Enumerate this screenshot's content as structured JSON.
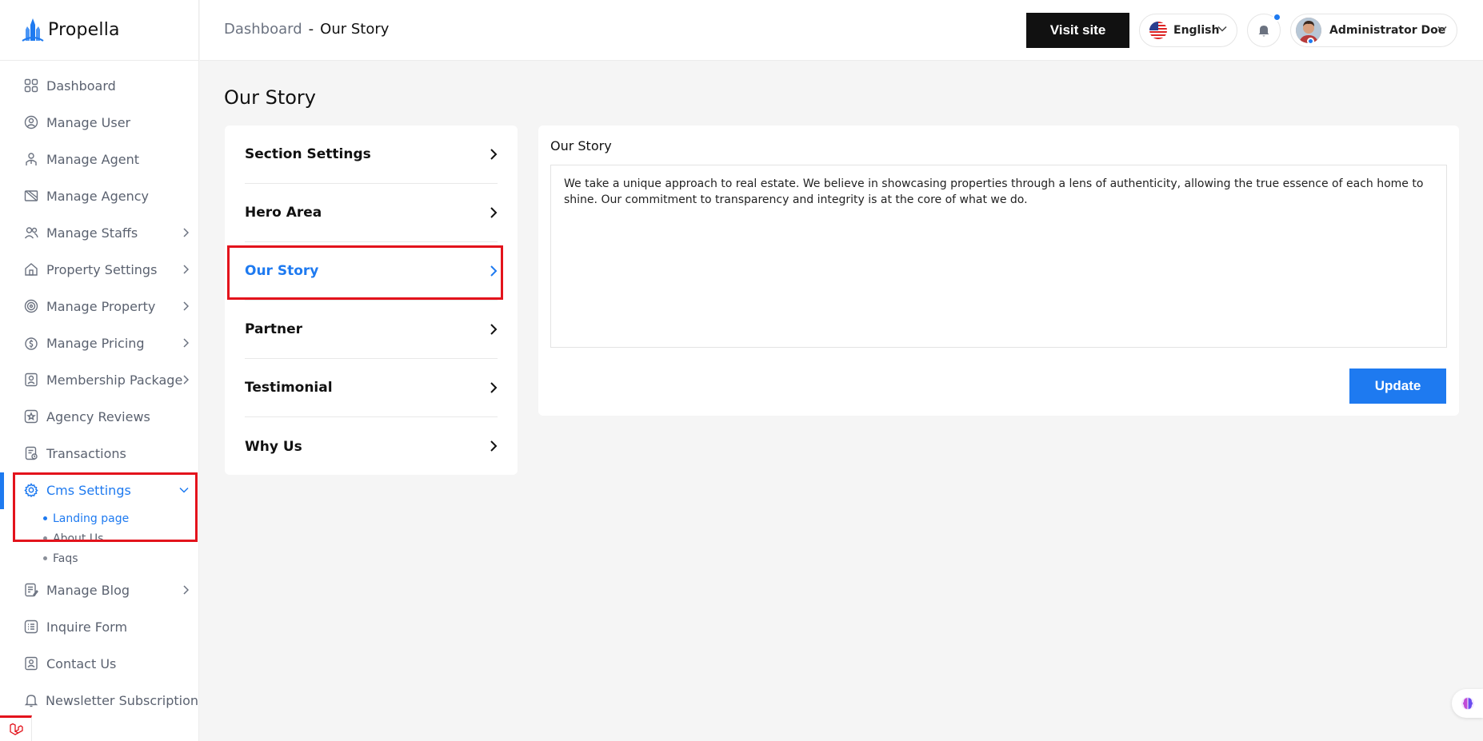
{
  "brand": {
    "name": "Propella"
  },
  "sidebar": {
    "items": [
      {
        "label": "Dashboard",
        "icon": "grid-icon"
      },
      {
        "label": "Manage User",
        "icon": "user-circle-icon"
      },
      {
        "label": "Manage Agent",
        "icon": "agent-icon"
      },
      {
        "label": "Manage Agency",
        "icon": "agency-icon"
      },
      {
        "label": "Manage Staffs",
        "icon": "users-icon"
      },
      {
        "label": "Property Settings",
        "icon": "home-icon"
      },
      {
        "label": "Manage Property",
        "icon": "property-icon"
      },
      {
        "label": "Manage Pricing",
        "icon": "pricing-icon"
      },
      {
        "label": "Membership Package",
        "icon": "membership-icon"
      },
      {
        "label": "Agency Reviews",
        "icon": "star-icon"
      },
      {
        "label": "Transactions",
        "icon": "receipt-icon"
      },
      {
        "label": "Cms Settings",
        "icon": "gear-icon"
      },
      {
        "label": "Manage Blog",
        "icon": "blog-icon"
      },
      {
        "label": "Inquire Form",
        "icon": "list-icon"
      },
      {
        "label": "Contact Us",
        "icon": "contact-icon"
      },
      {
        "label": "Newsletter Subscription",
        "icon": "bell-icon"
      }
    ],
    "cms_sub": [
      "Landing page",
      "About Us",
      "Faqs"
    ]
  },
  "header": {
    "breadcrumb": {
      "root": "Dashboard",
      "separator": "-",
      "current": "Our Story"
    },
    "visit_site": "Visit site",
    "language": "English",
    "user_name": "Administrator Doe"
  },
  "main": {
    "title": "Our Story",
    "menu": [
      "Section Settings",
      "Hero Area",
      "Our Story",
      "Partner",
      "Testimonial",
      "Why Us"
    ],
    "editor": {
      "label": "Our Story",
      "text": "We take a unique approach to real estate. We believe in showcasing properties through a lens of authenticity, allowing the true essence of each home to shine. Our commitment to transparency and integrity is at the core of what we do.",
      "update": "Update"
    }
  },
  "colors": {
    "accent": "#1e7af0",
    "highlight": "#e3131c",
    "dark": "#111111"
  }
}
